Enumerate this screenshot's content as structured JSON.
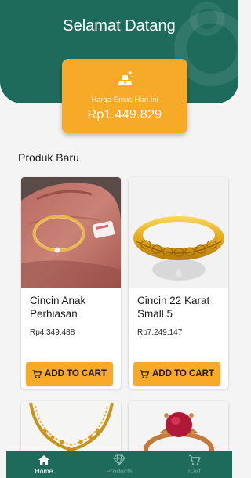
{
  "header": {
    "title": "Selamat Datang"
  },
  "price_card": {
    "label": "Harga Emas Hari Ini",
    "value": "Rp1.449.829",
    "icon": "gold-bars-icon"
  },
  "section": {
    "title": "Produk Baru"
  },
  "products": [
    {
      "name": "Cincin Anak Perhiasan",
      "price": "Rp4.349.488",
      "cart_label": "ADD TO CART"
    },
    {
      "name": "Cincin 22 Karat Small 5",
      "price": "Rp7.249.147",
      "cart_label": "ADD TO CART"
    }
  ],
  "nav": {
    "items": [
      {
        "label": "Home",
        "icon": "home-icon",
        "active": true
      },
      {
        "label": "Products",
        "icon": "diamond-icon",
        "active": false
      },
      {
        "label": "Cart",
        "icon": "cart-icon",
        "active": false
      }
    ]
  },
  "colors": {
    "primary": "#1e6b5c",
    "accent": "#f7a928",
    "background": "#f4f4f4"
  }
}
